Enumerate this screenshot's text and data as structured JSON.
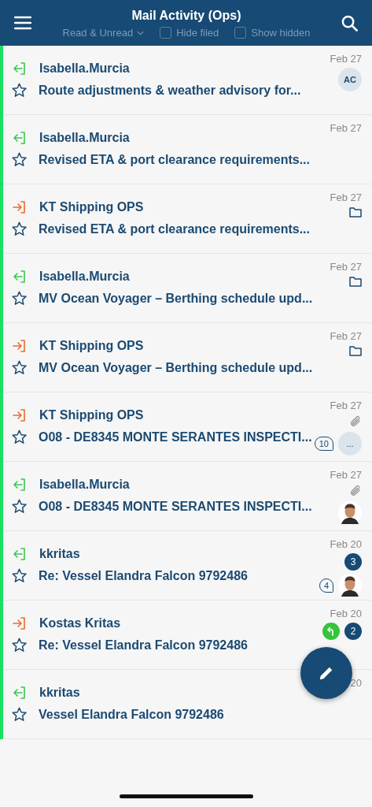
{
  "header": {
    "title": "Mail Activity (Ops)",
    "filter": "Read & Unread",
    "checkboxes": [
      {
        "label": "Hide filed",
        "checked": false
      },
      {
        "label": "Show hidden",
        "checked": false
      }
    ]
  },
  "rows": [
    {
      "kind": "in",
      "sender": "Isabella.Murcia",
      "subject": "Route adjustments & weather advisory for...",
      "date": "Feb 27",
      "starred": false,
      "attachment": false,
      "folder": false,
      "avatar": {
        "kind": "initials",
        "text": "AC"
      }
    },
    {
      "kind": "in",
      "sender": "Isabella.Murcia",
      "subject": "Revised ETA & port clearance requirements...",
      "date": "Feb 27",
      "starred": false,
      "attachment": false,
      "folder": false
    },
    {
      "kind": "out",
      "sender": "KT Shipping OPS",
      "subject": "Revised ETA & port clearance requirements...",
      "date": "Feb 27",
      "starred": false,
      "attachment": false,
      "folder": true
    },
    {
      "kind": "in",
      "sender": "Isabella.Murcia",
      "subject": "MV Ocean Voyager – Berthing schedule upd...",
      "date": "Feb 27",
      "starred": false,
      "attachment": false,
      "folder": true
    },
    {
      "kind": "out",
      "sender": "KT Shipping OPS",
      "subject": "MV Ocean Voyager – Berthing schedule upd...",
      "date": "Feb 27",
      "starred": false,
      "attachment": false,
      "folder": true
    },
    {
      "kind": "out",
      "sender": "KT Shipping OPS",
      "subject": "O08 - DE8345 MONTE SERANTES INSPECTI...",
      "date": "Feb 27",
      "starred": false,
      "attachment": true,
      "folder": false,
      "comments": "10",
      "more": "..."
    },
    {
      "kind": "in",
      "sender": "Isabella.Murcia",
      "subject": "O08 - DE8345 MONTE SERANTES INSPECTI...",
      "date": "Feb 27",
      "starred": false,
      "attachment": true,
      "folder": false
    },
    {
      "kind": "in",
      "sender": "kkritas",
      "subject": "Re: Vessel Elandra Falcon 9792486",
      "date": "Feb 20",
      "starred": false,
      "attachment": false,
      "folder": false,
      "unread": "3",
      "comments": "4"
    },
    {
      "kind": "out",
      "sender": "Kostas Kritas",
      "subject": "Re: Vessel Elandra Falcon 9792486",
      "date": "Feb 20",
      "starred": false,
      "attachment": false,
      "folder": false,
      "replied": true,
      "unread": "2"
    },
    {
      "kind": "in",
      "sender": "kkritas",
      "subject": "Vessel Elandra Falcon 9792486",
      "date": "20",
      "starred": false,
      "attachment": false,
      "folder": false
    }
  ]
}
